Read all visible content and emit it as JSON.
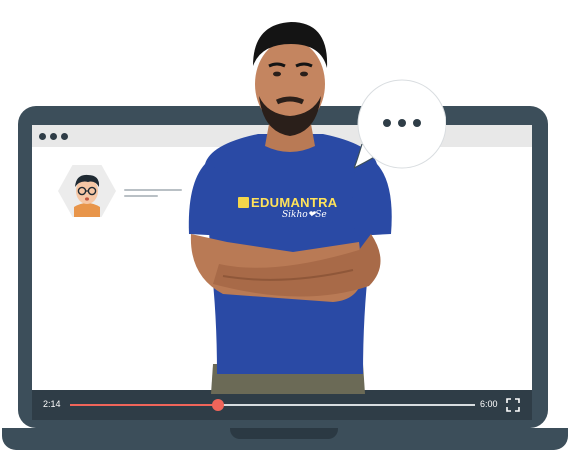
{
  "browser": {
    "dots": [
      "window-dot",
      "window-dot",
      "window-dot"
    ]
  },
  "player": {
    "current_time": "2:14",
    "total_time": "6:00",
    "progress": 0.366,
    "fullscreen_icon": "fullscreen-icon"
  },
  "chat": {
    "avatar_icon": "avatar-icon",
    "bubble_icon": "speech-bubble-icon"
  },
  "shirt": {
    "brand": "EDUMANTRA",
    "tagline": "Sikho❤Se"
  },
  "colors": {
    "laptop": "#3c4e5a",
    "control_bar": "#2f3d47",
    "accent": "#f0655a",
    "shirt": "#2a4aa5"
  }
}
